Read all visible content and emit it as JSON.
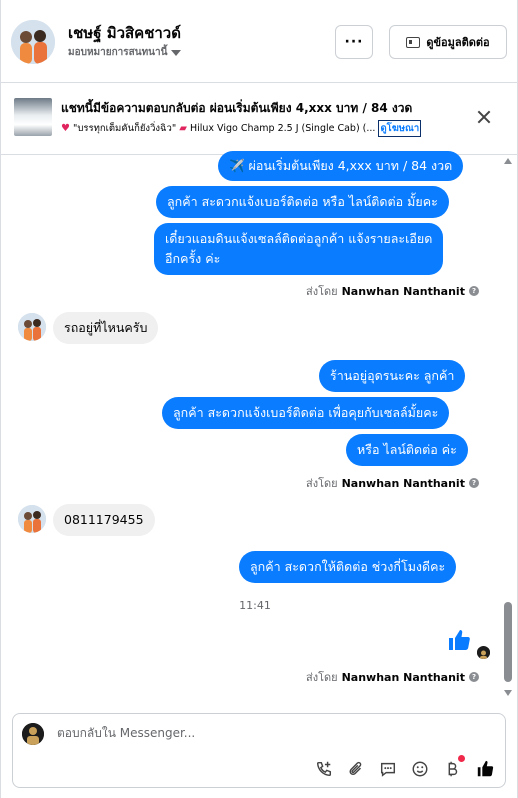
{
  "header": {
    "contact_name": "เชษฐ์ มิวสิคชาวด์",
    "assign_label": "มอบหมายการสนทนานี้",
    "more_label": "···",
    "info_label": "ดูข้อมูลติดต่อ"
  },
  "ad": {
    "title": "แชทนี้มีข้อความตอบกลับต่อ ผ่อนเริ่มต้นเพียง 4,xxx บาท / 84 งวด",
    "sub_text": "\"บรรทุกเต็มคันก็ยังวิ่งฉิว\"",
    "car_text": "Hilux Vigo Champ 2.5 J (Single Cab) (...",
    "link_label": "ดูโฆษณา"
  },
  "messages": {
    "m1": "✈️ ผ่อนเริ่มต้นเพียง 4,xxx บาท / 84 งวด",
    "m2": "ลูกค้า  สะดวกแจ้งเบอร์ติดต่อ หรือ ไลน์ติดต่อ มั้ยคะ",
    "m3_line1": "เดี๋ยวแอมดินแจ้งเซลล์ติดต่อลูกค้า  แจ้งรายละเอียด",
    "m3_line2": "อีกครั้ง ค่ะ",
    "sent_by_1": "ส่งโดย",
    "sender_name_1": "Nanwhan Nanthanit",
    "in1": "รถอยู่ที่ไหนครับ",
    "m4": "ร้านอยู่อุดรนะคะ  ลูกค้า",
    "m5": "ลูกค้า สะดวกแจ้งเบอร์ติดต่อ เพื่อคุยกับเซลล์มั้ยคะ",
    "m6": "หรือ ไลน์ติดต่อ ค่ะ",
    "sent_by_2": "ส่งโดย",
    "sender_name_2": "Nanwhan Nanthanit",
    "in2": "0811179455",
    "m7": "ลูกค้า  สะดวกให้ติดต่อ ช่วงกี่โมงดีคะ",
    "timestamp": "11:41",
    "sent_by_3": "ส่งโดย",
    "sender_name_3": "Nanwhan Nanthanit"
  },
  "composer": {
    "placeholder": "ตอบกลับใน Messenger..."
  },
  "colors": {
    "accent": "#0a7cff",
    "incoming_bubble": "#f0f0f0"
  }
}
